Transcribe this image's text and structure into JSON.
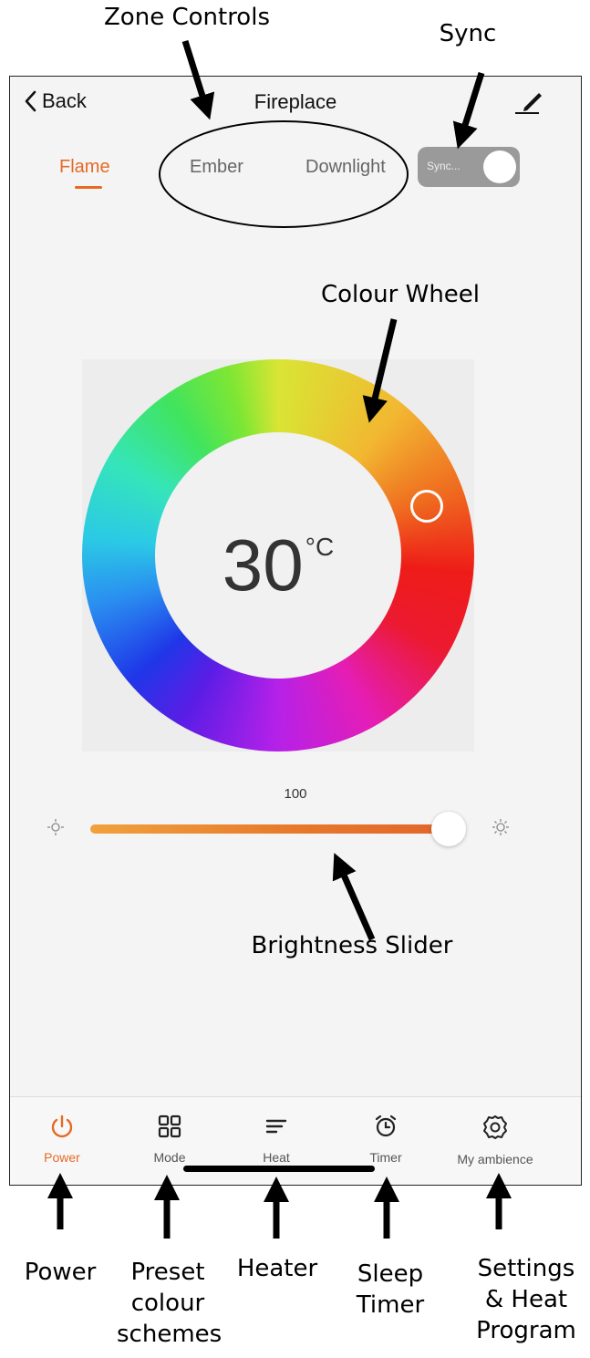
{
  "annotations": {
    "zone_controls": "Zone Controls",
    "sync": "Sync",
    "colour_wheel": "Colour Wheel",
    "brightness_slider": "Brightness Slider",
    "power": "Power",
    "preset_line1": "Preset",
    "preset_line2": "colour",
    "preset_line3": "schemes",
    "heater": "Heater",
    "sleep_line1": "Sleep",
    "sleep_line2": "Timer",
    "settings_line1": "Settings",
    "settings_line2": "& Heat",
    "settings_line3": "Program"
  },
  "header": {
    "back_label": "Back",
    "title": "Fireplace"
  },
  "tabs": [
    {
      "label": "Flame",
      "active": true
    },
    {
      "label": "Ember",
      "active": false
    },
    {
      "label": "Downlight",
      "active": false
    }
  ],
  "sync_toggle": {
    "label": "Sync..."
  },
  "colour_wheel": {
    "temperature": "30",
    "unit": "°C"
  },
  "brightness": {
    "value": "100",
    "level": 1.0
  },
  "bottom_nav": [
    {
      "label": "Power",
      "icon": "power-icon",
      "active": true
    },
    {
      "label": "Mode",
      "icon": "grid-icon",
      "active": false
    },
    {
      "label": "Heat",
      "icon": "lines-icon",
      "active": false
    },
    {
      "label": "Timer",
      "icon": "alarm-clock-icon",
      "active": false
    },
    {
      "label": "My ambience",
      "icon": "gear-icon",
      "active": false
    }
  ],
  "colors": {
    "accent": "#e56a25",
    "toggle_bg": "#9a9a9a",
    "panel_bg": "#f4f4f4"
  }
}
